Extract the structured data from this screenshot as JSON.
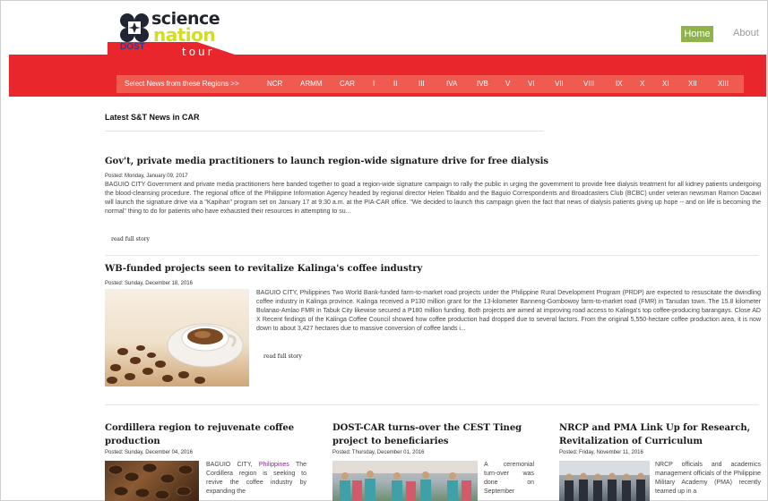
{
  "logo": {
    "science": "science",
    "nation": "nation",
    "tour": "tour",
    "dost": "DOST"
  },
  "nav": {
    "home": "Home",
    "about": "About"
  },
  "regions": {
    "label": "Select News from these Regions >>",
    "items": [
      "NCR",
      "ARMM",
      "CAR",
      "I",
      "II",
      "III",
      "IVA",
      "IVB",
      "V",
      "VI",
      "VII",
      "VIII",
      "IX",
      "X",
      "XI",
      "XII",
      "XIII"
    ]
  },
  "section": {
    "title": "Latest S&T News in CAR"
  },
  "articles": [
    {
      "title": "Gov't, private media practitioners to launch region-wide signature drive for free dialysis",
      "posted": "Posted: Monday, January 09, 2017",
      "body": "BAGUIO CITY  Government and private media practitioners here banded together to goad a region-wide signature campaign to rally the public in urging the government to provide free dialysis treatment for all kidney patients undergoing the blood-cleansing procedure. The regional office of the Philippine Information Agency headed by regional director Helen Tibaldo and the Baguio Correspondents and Broadcasters Club (BCBC) under veteran newsman Ramon Dacawi will launch the signature drive via a \"Kapihan\" program set on January 17 at 9:30 a.m. at the PIA-CAR office. \"We decided to launch this campaign given the fact that news of dialysis patients giving  up hope  -- and on life  is becoming the normal\" thing to do for patients who have exhausted their resources in attempting to su...",
      "read_more": "read full story"
    },
    {
      "title": "WB-funded projects seen to revitalize Kalinga's coffee industry",
      "posted": "Posted: Sunday, December 18, 2016",
      "body": "BAGUIO CITY, Philippines Two World Bank-funded farm-to-market road projects under the Philippine Rural Development Program (PRDP) are expected to resuscitate the dwindling coffee industry in Kalinga province. Kalinga received a P130 million grant for the 13-kilometer Banneng-Gombowoy farm-to-market road (FMR) in Tanudan town. The 15.8 kilometer Bulanao-Amlao FMR in Tabuk City likewise secured a P180 million funding. Both projects are aimed at improving road access to Kalinga's top coffee-producing barangays. Close AD X Recent findings of the Kalinga Coffee Council showed how coffee production had dropped due to several factors. From the original 5,550-hectare coffee production area, it is now down to about 3,427 hectares due to massive conversion of coffee lands i...",
      "read_more": "read full story"
    }
  ],
  "columns": [
    {
      "title": "Cordillera region to rejuvenate coffee production",
      "posted": "Posted: Sunday, December 04, 2016",
      "body_a": "BAGUIO CITY,",
      "body_b": "Philippines",
      "body_c": "The Cordillera region is seeking to revive the coffee industry by expanding the"
    },
    {
      "title": "DOST-CAR turns-over the CEST Tineg project to beneficiaries",
      "posted": "Posted: Thursday, December 01, 2016",
      "body": "A ceremonial turn-over was done on September"
    },
    {
      "title": "NRCP and PMA Link Up for Research, Revitalization of Curriculum",
      "posted": "Posted: Friday, November 11, 2016",
      "body": "NRCP officials and academics management officials of the Philippine Military Academy (PMA) recently teamed up in a"
    }
  ],
  "colors": {
    "red": "#e8262b",
    "region_bar": "#ef5a51",
    "home_bg": "#8fb24a",
    "logo_yellow": "#d4de20"
  }
}
